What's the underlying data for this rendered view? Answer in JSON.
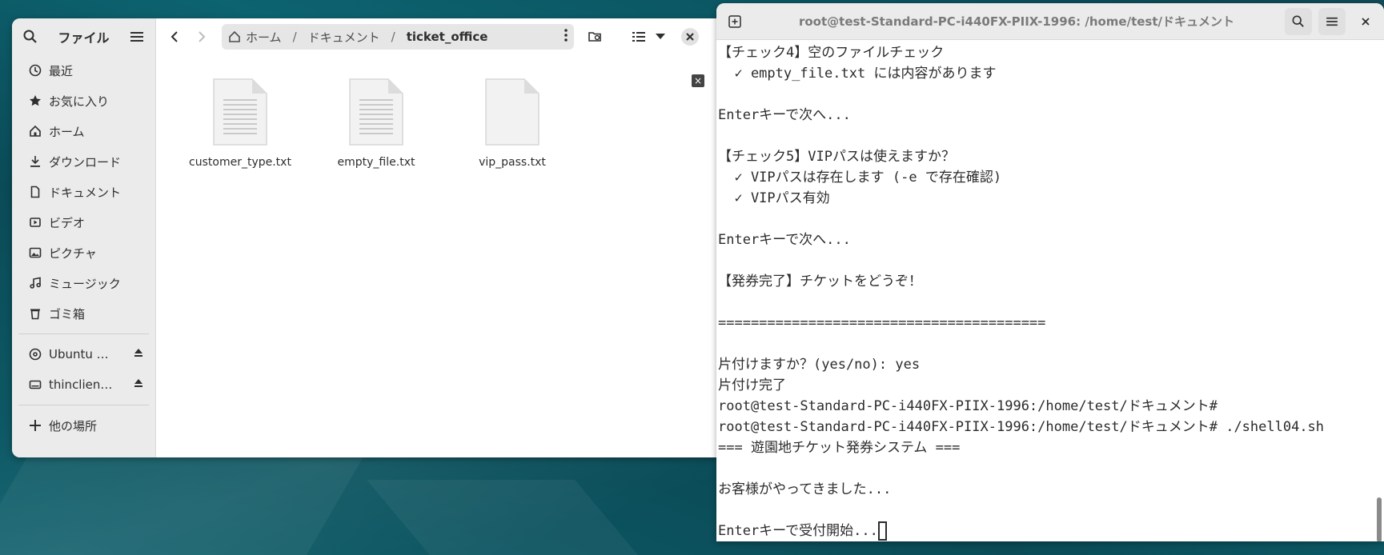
{
  "files_window": {
    "title": "ファイル",
    "sidebar": {
      "items": [
        {
          "label": "最近",
          "icon": "clock-icon"
        },
        {
          "label": "お気に入り",
          "icon": "star-icon"
        },
        {
          "label": "ホーム",
          "icon": "home-icon"
        },
        {
          "label": "ダウンロード",
          "icon": "download-icon"
        },
        {
          "label": "ドキュメント",
          "icon": "document-icon"
        },
        {
          "label": "ビデオ",
          "icon": "video-icon"
        },
        {
          "label": "ピクチャ",
          "icon": "picture-icon"
        },
        {
          "label": "ミュージック",
          "icon": "music-icon"
        },
        {
          "label": "ゴミ箱",
          "icon": "trash-icon"
        }
      ],
      "drives": [
        {
          "label": "Ubuntu 2…",
          "icon": "disc-icon"
        },
        {
          "label": "thinclient…",
          "icon": "drive-icon"
        }
      ],
      "other_places": "他の場所"
    },
    "breadcrumb": {
      "home": "ホーム",
      "documents": "ドキュメント",
      "current": "ticket_office"
    },
    "files": [
      {
        "name": "customer_type.txt",
        "has_content": true
      },
      {
        "name": "empty_file.txt",
        "has_content": true
      },
      {
        "name": "vip_pass.txt",
        "has_content": false
      }
    ],
    "badge": "×"
  },
  "terminal": {
    "title": "root@test-Standard-PC-i440FX-PIIX-1996: /home/test/ドキュメント",
    "lines": [
      "【チェック4】空のファイルチェック",
      "  ✓ empty_file.txt には内容があります",
      "",
      "Enterキーで次へ...",
      "",
      "【チェック5】VIPパスは使えますか？",
      "  ✓ VIPパスは存在します (-e で存在確認)",
      "  ✓ VIPパス有効",
      "",
      "Enterキーで次へ...",
      "",
      "【発券完了】チケットをどうぞ！",
      "",
      "========================================",
      "",
      "片付けますか？(yes/no): yes",
      "片付け完了",
      "root@test-Standard-PC-i440FX-PIIX-1996:/home/test/ドキュメント#",
      "root@test-Standard-PC-i440FX-PIIX-1996:/home/test/ドキュメント# ./shell04.sh",
      "=== 遊園地チケット発券システム ===",
      "",
      "お客様がやってきました...",
      "",
      "Enterキーで受付開始..."
    ]
  }
}
